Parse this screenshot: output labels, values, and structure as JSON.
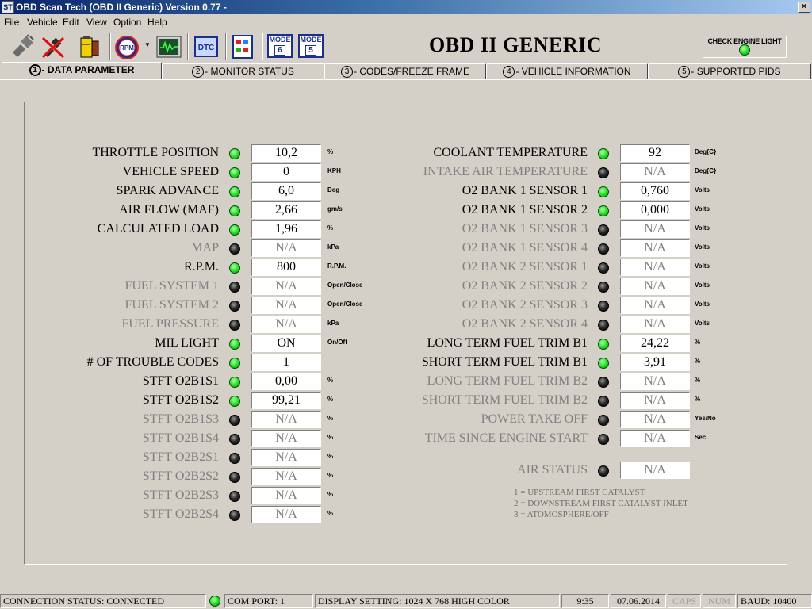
{
  "window": {
    "title": "OBD Scan Tech (OBD II Generic) Version 0.77 -",
    "icon_text": "ST",
    "close": "×"
  },
  "menu": [
    "File",
    "Vehicle",
    "Edit",
    "View",
    "Option",
    "Help"
  ],
  "toolbar": {
    "icons": [
      "connect-cable-icon",
      "disconnect-icon",
      "battery-icon",
      "rpm-gauge-icon",
      "oscilloscope-icon",
      "dtc-icon",
      "freeze-frame-icon",
      "mode-6-icon",
      "mode-5-icon"
    ],
    "rpm_label": "RPM",
    "dtc_label": "DTC",
    "mode6": {
      "label": "MODE",
      "num": "6"
    },
    "mode5": {
      "label": "MODE",
      "num": "5"
    }
  },
  "brand": "OBD II GENERIC",
  "check_engine": {
    "label": "CHECK ENGINE LIGHT",
    "on": true
  },
  "tabs": [
    {
      "num": "1",
      "label": "- DATA PARAMETER",
      "active": true
    },
    {
      "num": "2",
      "label": "- MONITOR STATUS",
      "active": false
    },
    {
      "num": "3",
      "label": "- CODES/FREEZE FRAME",
      "active": false
    },
    {
      "num": "4",
      "label": "- VEHICLE INFORMATION",
      "active": false
    },
    {
      "num": "5",
      "label": "- SUPPORTED PIDS",
      "active": false
    }
  ],
  "left_params": [
    {
      "label": "THROTTLE POSITION",
      "value": "10,2",
      "unit": "%",
      "active": true
    },
    {
      "label": "VEHICLE SPEED",
      "value": "0",
      "unit": "KPH",
      "active": true
    },
    {
      "label": "SPARK ADVANCE",
      "value": "6,0",
      "unit": "Deg",
      "active": true
    },
    {
      "label": "AIR FLOW (MAF)",
      "value": "2,66",
      "unit": "gm/s",
      "active": true
    },
    {
      "label": "CALCULATED LOAD",
      "value": "1,96",
      "unit": "%",
      "active": true
    },
    {
      "label": "MAP",
      "value": "N/A",
      "unit": "kPa",
      "active": false
    },
    {
      "label": "R.P.M.",
      "value": "800",
      "unit": "R.P.M.",
      "active": true
    },
    {
      "label": "FUEL SYSTEM 1",
      "value": "N/A",
      "unit": "Open/Close",
      "active": false
    },
    {
      "label": "FUEL SYSTEM 2",
      "value": "N/A",
      "unit": "Open/Close",
      "active": false
    },
    {
      "label": "FUEL PRESSURE",
      "value": "N/A",
      "unit": "kPa",
      "active": false
    },
    {
      "label": "MIL LIGHT",
      "value": "ON",
      "unit": "On/Off",
      "active": true
    },
    {
      "label": "# OF TROUBLE CODES",
      "value": "1",
      "unit": "",
      "active": true
    },
    {
      "label": "STFT O2B1S1",
      "value": "0,00",
      "unit": "%",
      "active": true
    },
    {
      "label": "STFT O2B1S2",
      "value": "99,21",
      "unit": "%",
      "active": true
    },
    {
      "label": "STFT O2B1S3",
      "value": "N/A",
      "unit": "%",
      "active": false
    },
    {
      "label": "STFT O2B1S4",
      "value": "N/A",
      "unit": "%",
      "active": false
    },
    {
      "label": "STFT O2B2S1",
      "value": "N/A",
      "unit": "%",
      "active": false
    },
    {
      "label": "STFT O2B2S2",
      "value": "N/A",
      "unit": "%",
      "active": false
    },
    {
      "label": "STFT O2B2S3",
      "value": "N/A",
      "unit": "%",
      "active": false
    },
    {
      "label": "STFT O2B2S4",
      "value": "N/A",
      "unit": "%",
      "active": false
    }
  ],
  "right_params": [
    {
      "label": "COOLANT TEMPERATURE",
      "value": "92",
      "unit": "Deg{C}",
      "active": true
    },
    {
      "label": "INTAKE AIR TEMPERATURE",
      "value": "N/A",
      "unit": "Deg{C}",
      "active": false
    },
    {
      "label": "O2 BANK 1 SENSOR 1",
      "value": "0,760",
      "unit": "Volts",
      "active": true
    },
    {
      "label": "O2 BANK 1 SENSOR 2",
      "value": "0,000",
      "unit": "Volts",
      "active": true
    },
    {
      "label": "O2 BANK 1 SENSOR 3",
      "value": "N/A",
      "unit": "Volts",
      "active": false
    },
    {
      "label": "O2 BANK 1 SENSOR 4",
      "value": "N/A",
      "unit": "Volts",
      "active": false
    },
    {
      "label": "O2 BANK 2 SENSOR 1",
      "value": "N/A",
      "unit": "Volts",
      "active": false
    },
    {
      "label": "O2 BANK 2 SENSOR 2",
      "value": "N/A",
      "unit": "Volts",
      "active": false
    },
    {
      "label": "O2 BANK 2 SENSOR 3",
      "value": "N/A",
      "unit": "Volts",
      "active": false
    },
    {
      "label": "O2 BANK 2 SENSOR 4",
      "value": "N/A",
      "unit": "Volts",
      "active": false
    },
    {
      "label": "LONG TERM FUEL TRIM B1",
      "value": "24,22",
      "unit": "%",
      "active": true
    },
    {
      "label": "SHORT TERM FUEL TRIM B1",
      "value": "3,91",
      "unit": "%",
      "active": true
    },
    {
      "label": "LONG TERM FUEL TRIM B2",
      "value": "N/A",
      "unit": "%",
      "active": false
    },
    {
      "label": "SHORT TERM FUEL TRIM B2",
      "value": "N/A",
      "unit": "%",
      "active": false
    },
    {
      "label": "POWER TAKE OFF",
      "value": "N/A",
      "unit": "Yes/No",
      "active": false
    },
    {
      "label": "TIME SINCE ENGINE START",
      "value": "N/A",
      "unit": "Sec",
      "active": false
    }
  ],
  "air_status": {
    "label": "AIR STATUS",
    "value": "N/A",
    "active": false,
    "notes": [
      "1 = UPSTREAM FIRST CATALYST",
      "2 = DOWNSTREAM FIRST CATALYST INLET",
      "3 = ATOMOSPHERE/OFF"
    ]
  },
  "status": {
    "connection": "CONNECTION STATUS:  CONNECTED",
    "connected": true,
    "com_port": "COM PORT:  1",
    "display": "DISPLAY SETTING:  1024 X  768    HIGH COLOR",
    "time": "9:35",
    "date": "07.06.2014",
    "caps": "CAPS",
    "num": "NUM",
    "baud": "BAUD: 10400"
  },
  "colors": {
    "led_on": "#2ee82e",
    "led_off": "#1a1a1a",
    "inactive_text": "#808080",
    "title_bar": "#0a246a",
    "mode_blue": "#1a2f8f"
  }
}
